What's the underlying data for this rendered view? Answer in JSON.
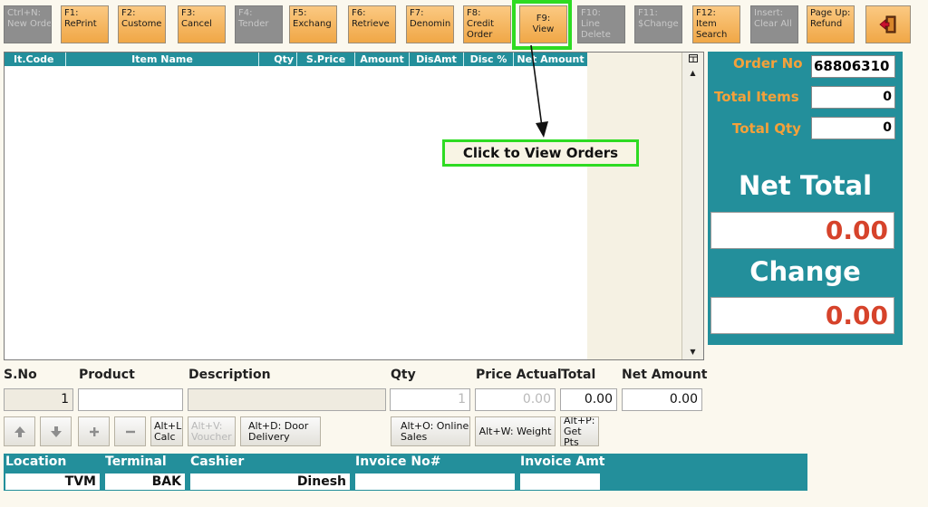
{
  "toolbar": {
    "keys": [
      {
        "key": "Ctrl+N:",
        "label": "New Order",
        "enabled": false
      },
      {
        "key": "F1:",
        "label": "RePrint",
        "enabled": true
      },
      {
        "key": "F2:",
        "label": "Custome",
        "enabled": true
      },
      {
        "key": "F3:",
        "label": "Cancel",
        "enabled": true
      },
      {
        "key": "F4:",
        "label": "Tender",
        "enabled": false
      },
      {
        "key": "F5:",
        "label": "Exchang",
        "enabled": true
      },
      {
        "key": "F6:",
        "label": "Retrieve",
        "enabled": true
      },
      {
        "key": "F7:",
        "label": "Denomin",
        "enabled": true
      },
      {
        "key": "F8:",
        "label": "Credit Order",
        "enabled": true
      },
      {
        "key": "F9:",
        "label": "View",
        "enabled": true
      },
      {
        "key": "F10:",
        "label": "Line Delete",
        "enabled": false
      },
      {
        "key": "F11:",
        "label": "$Change",
        "enabled": false
      },
      {
        "key": "F12:",
        "label": "Item Search",
        "enabled": true
      },
      {
        "key": "Insert:",
        "label": "Clear All",
        "enabled": false
      },
      {
        "key": "Page Up:",
        "label": "Refund",
        "enabled": true
      }
    ],
    "exit_icon": "exit-door-icon"
  },
  "grid": {
    "columns": [
      "It.Code",
      "Item Name",
      "Qty",
      "S.Price",
      "Amount",
      "DisAmt",
      "Disc %",
      "Net Amount"
    ],
    "rows": []
  },
  "callout": {
    "text": "Click to View Orders"
  },
  "summary": {
    "order_no_label": "Order No",
    "order_no_value": "68806310",
    "total_items_label": "Total Items",
    "total_items_value": "0",
    "total_qty_label": "Total Qty",
    "total_qty_value": "0",
    "net_total_label": "Net Total",
    "net_total_value": "0.00",
    "change_label": "Change",
    "change_value": "0.00"
  },
  "entry": {
    "labels": {
      "sno": "S.No",
      "product": "Product",
      "description": "Description",
      "qty": "Qty",
      "price_actual": "Price Actual",
      "total": "Total",
      "net_amount": "Net Amount"
    },
    "values": {
      "sno": "1",
      "product": "",
      "description": "",
      "qty": "1",
      "price_actual": "0.00",
      "total": "0.00",
      "net_amount": "0.00"
    }
  },
  "actions": {
    "calc": "Alt+L: Calc",
    "voucher": "Alt+V: Voucher",
    "door_delivery": "Alt+D: Door Delivery",
    "online_sales": "Alt+O: Online Sales",
    "weight": "Alt+W: Weight",
    "get_pts": "Alt+P: Get Pts"
  },
  "footer": {
    "location_label": "Location",
    "location_value": "TVM",
    "terminal_label": "Terminal",
    "terminal_value": "BAK",
    "cashier_label": "Cashier",
    "cashier_value": "Dinesh",
    "invoice_no_label": "Invoice No#",
    "invoice_no_value": "",
    "invoice_amt_label": "Invoice Amt",
    "invoice_amt_value": ""
  },
  "colors": {
    "teal": "#238f9b",
    "orange": "#f0a746",
    "green_highlight": "#2edb22",
    "red_value": "#d6432b"
  }
}
